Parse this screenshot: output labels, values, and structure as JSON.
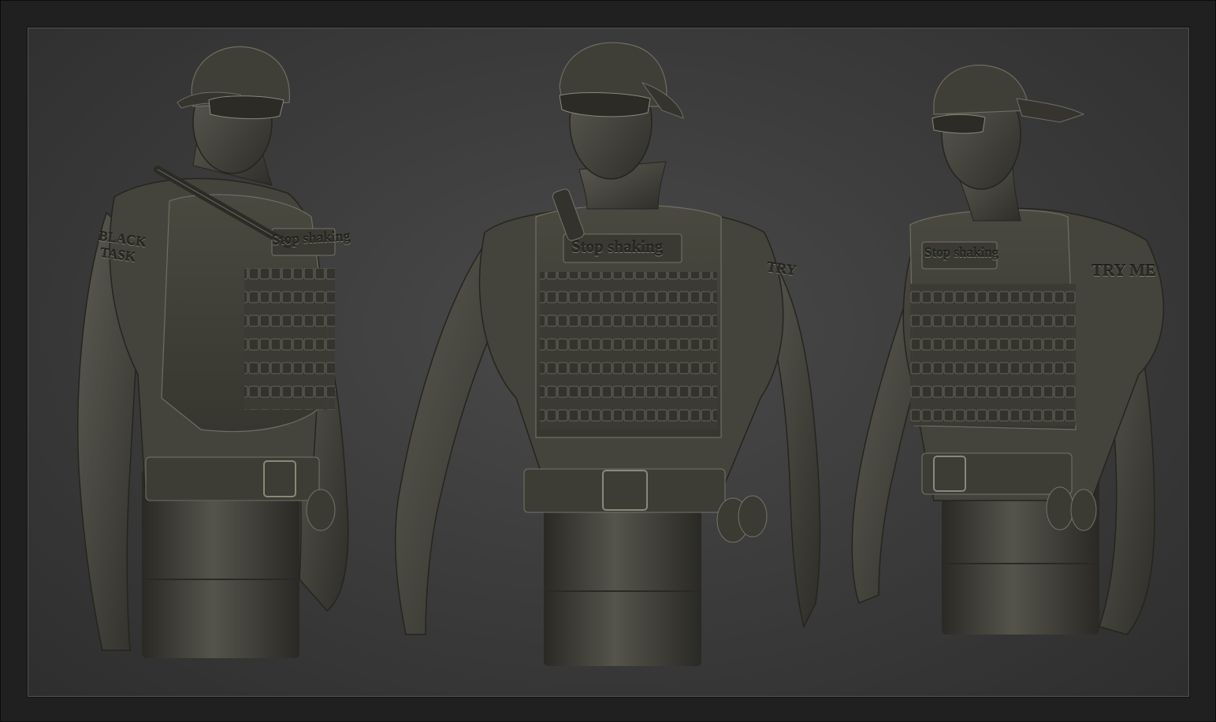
{
  "figures": [
    {
      "id": "left",
      "chest_patch": "Stop shaking",
      "sleeve_text_line1": "BLACK",
      "sleeve_text_line2": "TASK"
    },
    {
      "id": "center",
      "chest_patch": "Stop shaking",
      "sleeve_text_line1": "TRY"
    },
    {
      "id": "right",
      "chest_patch": "Stop shaking",
      "sleeve_text_line1": "TRY ME"
    }
  ],
  "colors": {
    "background": "#3d3d3d",
    "frame": "#202020",
    "clay": "#4e4d45",
    "clay_dark": "#2f2e29",
    "clay_highlight": "#8a8878"
  }
}
